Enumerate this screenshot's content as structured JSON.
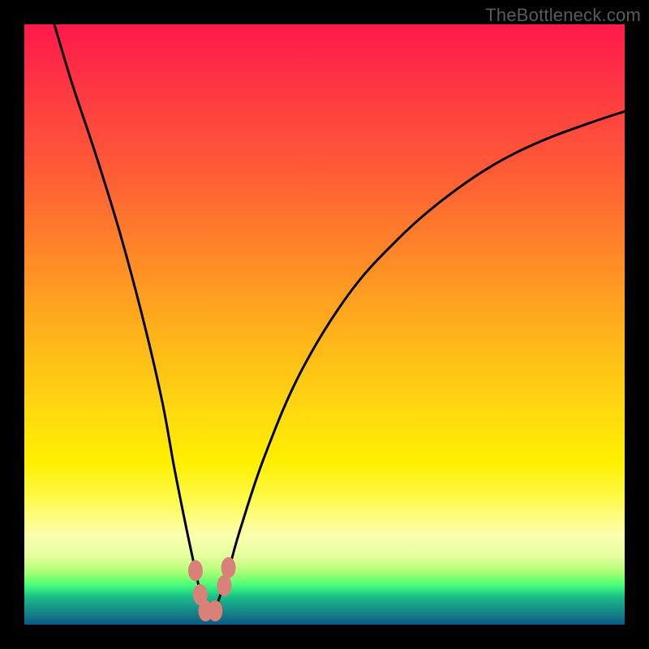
{
  "watermark": "TheBottleneck.com",
  "chart_data": {
    "type": "line",
    "title": "",
    "xlabel": "",
    "ylabel": "",
    "xlim": [
      0,
      100
    ],
    "ylim": [
      0,
      100
    ],
    "grid": false,
    "legend": false,
    "series": [
      {
        "name": "bottleneck-curve",
        "x": [
          5,
          8,
          12,
          16,
          20,
          23,
          25,
          27,
          28.5,
          29.5,
          30.5,
          31.5,
          32.5,
          34,
          36,
          40,
          46,
          54,
          62,
          70,
          78,
          86,
          94,
          100
        ],
        "y": [
          100,
          90,
          78,
          65,
          50,
          37,
          26,
          16,
          9,
          4.5,
          2.0,
          2.0,
          4.5,
          9,
          16,
          28,
          42,
          55,
          64,
          71,
          76.5,
          80.5,
          83.5,
          85.5
        ]
      }
    ],
    "markers": [
      {
        "name": "left-knee-top",
        "x": 28.5,
        "y": 9.0
      },
      {
        "name": "left-knee-mid",
        "x": 29.3,
        "y": 5.0
      },
      {
        "name": "valley-left",
        "x": 30.2,
        "y": 2.3
      },
      {
        "name": "valley-right",
        "x": 31.8,
        "y": 2.3
      },
      {
        "name": "right-knee-mid",
        "x": 33.3,
        "y": 6.5
      },
      {
        "name": "right-knee-top",
        "x": 34.0,
        "y": 9.5
      }
    ],
    "marker_color": "#d98178",
    "curve_color": "#000000"
  }
}
